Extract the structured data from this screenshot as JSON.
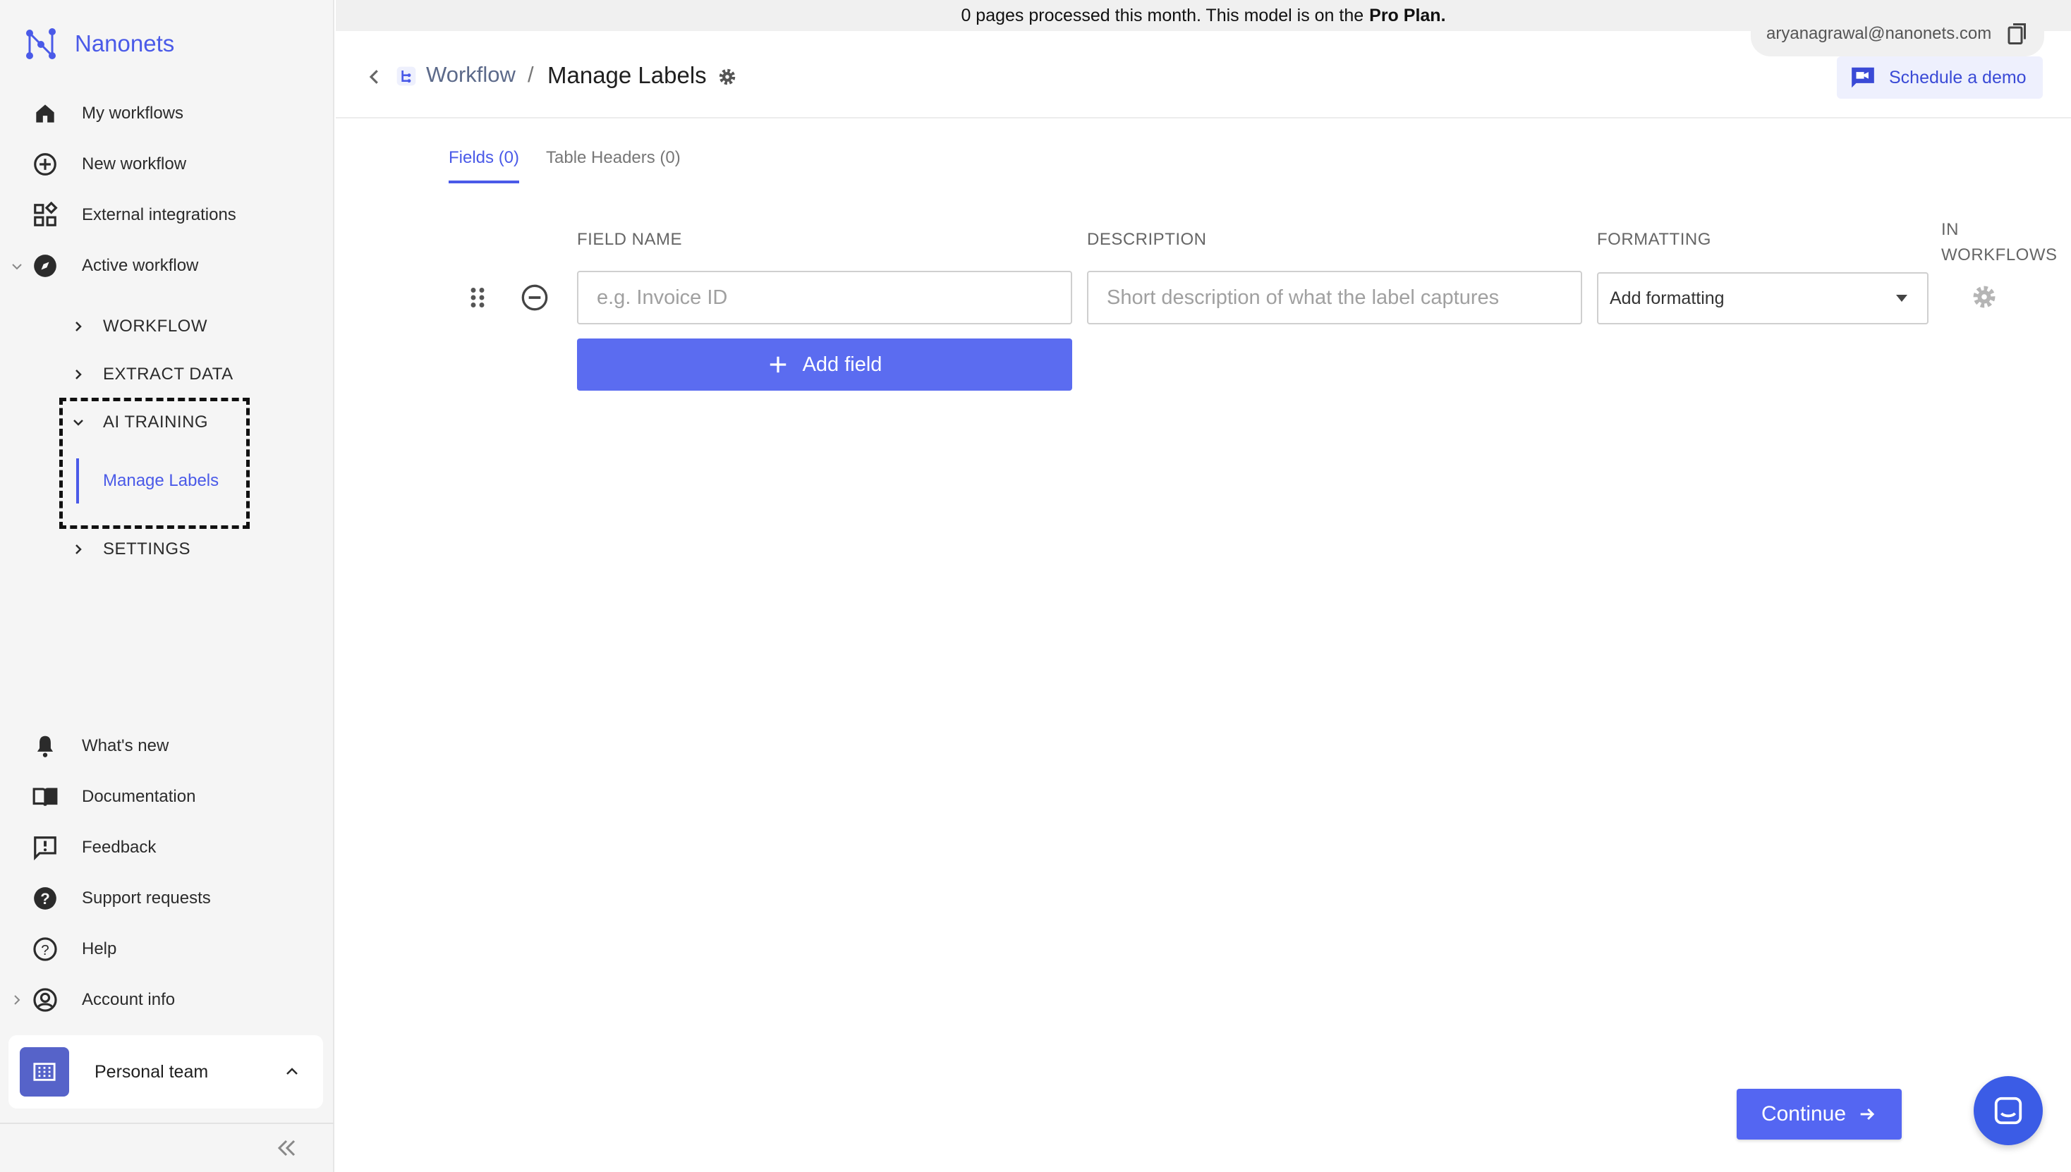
{
  "app": {
    "name": "Nanonets"
  },
  "banner": {
    "text": "0 pages processed this month. This model is on the",
    "plan": "Pro Plan."
  },
  "user": {
    "email": "aryanagrawal@nanonets.com"
  },
  "sidebar": {
    "items": [
      {
        "label": "My workflows",
        "icon": "home-icon"
      },
      {
        "label": "New workflow",
        "icon": "plus-circle-icon"
      },
      {
        "label": "External integrations",
        "icon": "grid-integrations-icon"
      },
      {
        "label": "Active workflow",
        "icon": "compass-icon"
      }
    ],
    "sub_items": [
      {
        "label": "WORKFLOW"
      },
      {
        "label": "EXTRACT DATA"
      },
      {
        "label": "AI TRAINING"
      },
      {
        "label": "SETTINGS"
      }
    ],
    "active_sub_link": "Manage Labels",
    "bottom_items": [
      {
        "label": "What's new",
        "icon": "bell-icon"
      },
      {
        "label": "Documentation",
        "icon": "book-icon"
      },
      {
        "label": "Feedback",
        "icon": "feedback-icon"
      },
      {
        "label": "Support requests",
        "icon": "help-circle-icon"
      },
      {
        "label": "Help",
        "icon": "question-icon"
      },
      {
        "label": "Account info",
        "icon": "account-icon"
      }
    ],
    "team": {
      "name": "Personal team"
    }
  },
  "header": {
    "breadcrumb_root": "Workflow",
    "breadcrumb_sep": "/",
    "breadcrumb_current": "Manage Labels",
    "demo_label": "Schedule a demo"
  },
  "tabs": [
    {
      "label": "Fields (0)",
      "active": true
    },
    {
      "label": "Table Headers (0)",
      "active": false
    }
  ],
  "table": {
    "columns": [
      "FIELD NAME",
      "DESCRIPTION",
      "FORMATTING",
      "IN",
      "WORKFLOWS"
    ],
    "row": {
      "field_name_placeholder": "e.g. Invoice ID",
      "description_placeholder": "Short description of what the label captures",
      "formatting_value": "Add formatting"
    },
    "add_field_label": "Add field"
  },
  "footer": {
    "continue_label": "Continue"
  },
  "colors": {
    "accent": "#4a5ae8",
    "button": "#5b6cf0",
    "sidebar_bg": "#f5f5f5"
  }
}
